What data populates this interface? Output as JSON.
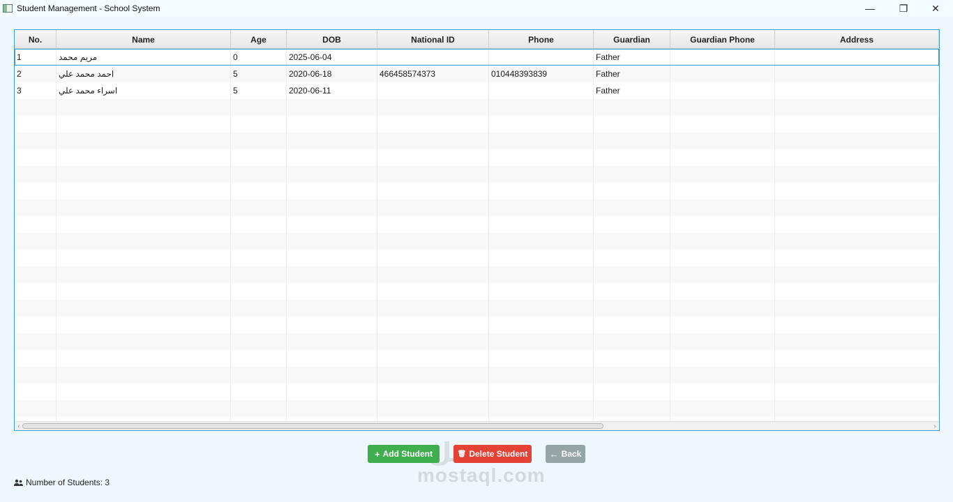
{
  "window": {
    "title": "Student Management - School System",
    "controls": {
      "minimize": "—",
      "maximize": "❐",
      "close": "✕"
    }
  },
  "table": {
    "columns": [
      "No.",
      "Name",
      "Age",
      "DOB",
      "National ID",
      "Phone",
      "Guardian",
      "Guardian Phone",
      "Address"
    ],
    "rows": [
      [
        "1",
        "مريم محمد",
        "0",
        "2025-06-04",
        "",
        "",
        "Father",
        "",
        ""
      ],
      [
        "2",
        "احمد محمد علي",
        "5",
        "2020-06-18",
        "466458574373",
        "010448393839",
        "Father",
        "",
        ""
      ],
      [
        "3",
        "اسراء محمد علي",
        "5",
        "2020-06-11",
        "",
        "",
        "Father",
        "",
        ""
      ]
    ],
    "selected_row": 0
  },
  "buttons": {
    "add": {
      "icon": "plus-icon",
      "glyph": "+",
      "label": "Add Student",
      "color": "#3fae4d"
    },
    "delete": {
      "icon": "trash-icon",
      "glyph": "🗑",
      "label": "Delete Student",
      "color": "#e34234"
    },
    "back": {
      "icon": "arrow-left-icon",
      "glyph": "←",
      "label": "Back",
      "color": "#95a5a6"
    }
  },
  "status": {
    "icon": "users-icon",
    "text": "Number of Students: 3"
  },
  "watermark": {
    "arabic": "مستقل",
    "latin": "mostaql.com"
  },
  "colors": {
    "accent": "#3a9fd6",
    "background": "#eef7fc"
  }
}
